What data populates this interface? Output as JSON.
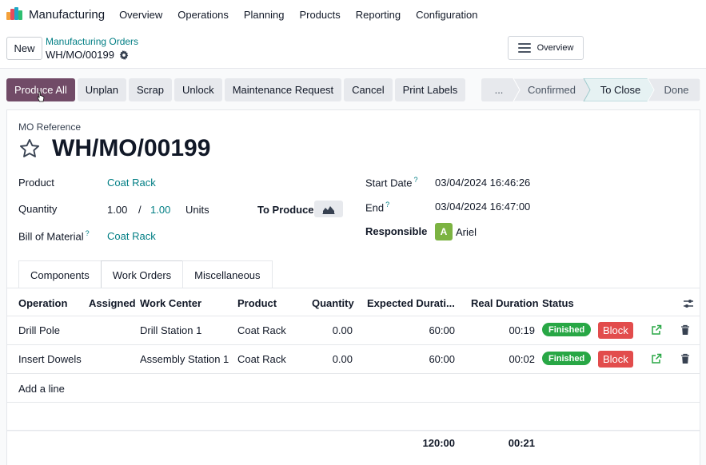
{
  "navbar": {
    "app_name": "Manufacturing",
    "menus": [
      "Overview",
      "Operations",
      "Planning",
      "Products",
      "Reporting",
      "Configuration"
    ]
  },
  "control_panel": {
    "new_label": "New",
    "breadcrumb": "Manufacturing Orders",
    "record_name": "WH/MO/00199",
    "overview_label": "Overview"
  },
  "actions": [
    "Produce All",
    "Unplan",
    "Scrap",
    "Unlock",
    "Maintenance Request",
    "Cancel",
    "Print Labels"
  ],
  "statusbar": {
    "stages": [
      "...",
      "Confirmed",
      "To Close",
      "Done"
    ],
    "active": "To Close"
  },
  "form": {
    "ref_label": "MO Reference",
    "ref_value": "WH/MO/00199",
    "product_label": "Product",
    "product_value": "Coat Rack",
    "quantity_label": "Quantity",
    "quantity_value": "1.00",
    "quantity_separator": "/",
    "quantity_target": "1.00",
    "quantity_uom": "Units",
    "to_produce_label": "To Produce",
    "bom_label": "Bill of Material",
    "bom_value": "Coat Rack",
    "start_label": "Start Date",
    "start_value": "03/04/2024 16:46:26",
    "end_label": "End",
    "end_value": "03/04/2024 16:47:00",
    "responsible_label": "Responsible",
    "responsible_initial": "A",
    "responsible_value": "Ariel",
    "help_mark": "?"
  },
  "tabs": [
    "Components",
    "Work Orders",
    "Miscellaneous"
  ],
  "active_tab": "Work Orders",
  "work_orders": {
    "columns": [
      "Operation",
      "Assigned",
      "Work Center",
      "Product",
      "Quantity",
      "Expected Durati...",
      "Real Duration",
      "Status"
    ],
    "rows": [
      {
        "operation": "Drill Pole",
        "assigned": "",
        "work_center": "Drill Station 1",
        "product": "Coat Rack",
        "quantity": "0.00",
        "expected": "60:00",
        "real": "00:19",
        "status": "Finished",
        "block_label": "Block"
      },
      {
        "operation": "Insert Dowels",
        "assigned": "",
        "work_center": "Assembly Station 1",
        "product": "Coat Rack",
        "quantity": "0.00",
        "expected": "60:00",
        "real": "00:02",
        "status": "Finished",
        "block_label": "Block"
      }
    ],
    "add_line": "Add a line",
    "total_expected": "120:00",
    "total_real": "00:21"
  },
  "colors": {
    "primary": "#714b67",
    "link": "#017e84",
    "finished": "#28a745",
    "block": "#e24c4c",
    "avatar": "#7cb342"
  }
}
